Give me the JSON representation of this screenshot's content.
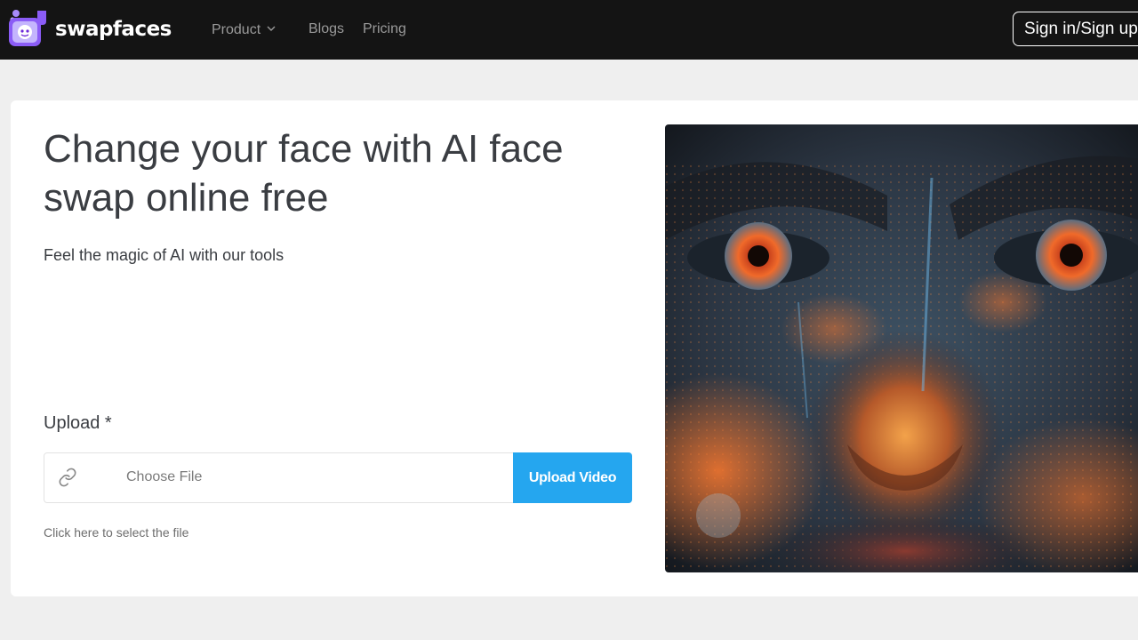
{
  "header": {
    "brand": "swapfaces",
    "nav": {
      "product": "Product",
      "blogs": "Blogs",
      "pricing": "Pricing"
    },
    "signin": "Sign in/Sign up"
  },
  "hero": {
    "headline": "Change your face with AI face swap online free",
    "subtitle": "Feel the magic of AI with our tools"
  },
  "upload": {
    "label": "Upload *",
    "file_placeholder": "Choose File",
    "button": "Upload Video",
    "hint": "Click here to select the file"
  },
  "colors": {
    "header_bg": "#141414",
    "accent": "#25a6ef",
    "logo": "#8b5cf6"
  },
  "icons": {
    "logo": "swapfaces-logo-icon",
    "product_caret": "chevron-down-icon",
    "upload_field": "link-icon"
  }
}
